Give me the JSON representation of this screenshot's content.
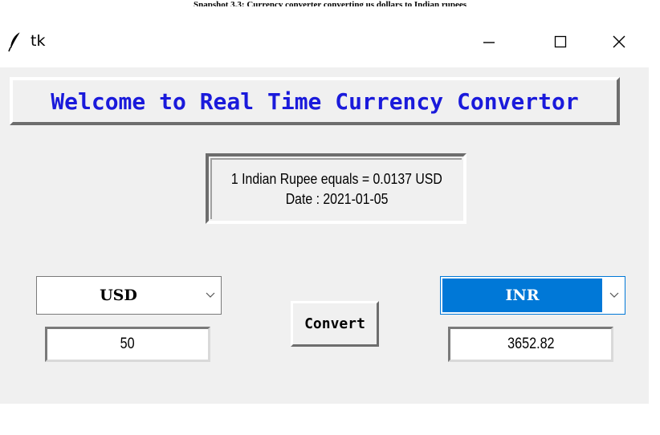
{
  "caption": "Snapshot 3.3: Currency converter converting us dollars to Indian rupees",
  "window": {
    "title": "tk",
    "minimize_symbol": "—",
    "maximize_symbol": "☐",
    "close_symbol": "X",
    "icon": "feather-icon"
  },
  "banner": {
    "text": "Welcome to Real Time Currency Convertor",
    "color": "#1a1adb"
  },
  "rate_info": {
    "line1": "1 Indian Rupee equals = 0.0137 USD",
    "line2": "Date : 2021-01-05"
  },
  "from": {
    "currency": "USD",
    "amount": "50"
  },
  "to": {
    "currency": "INR",
    "amount": "3652.82"
  },
  "convert_button": {
    "label": "Convert"
  },
  "colors": {
    "accent": "#0078d7",
    "background": "#f0f0f0"
  }
}
